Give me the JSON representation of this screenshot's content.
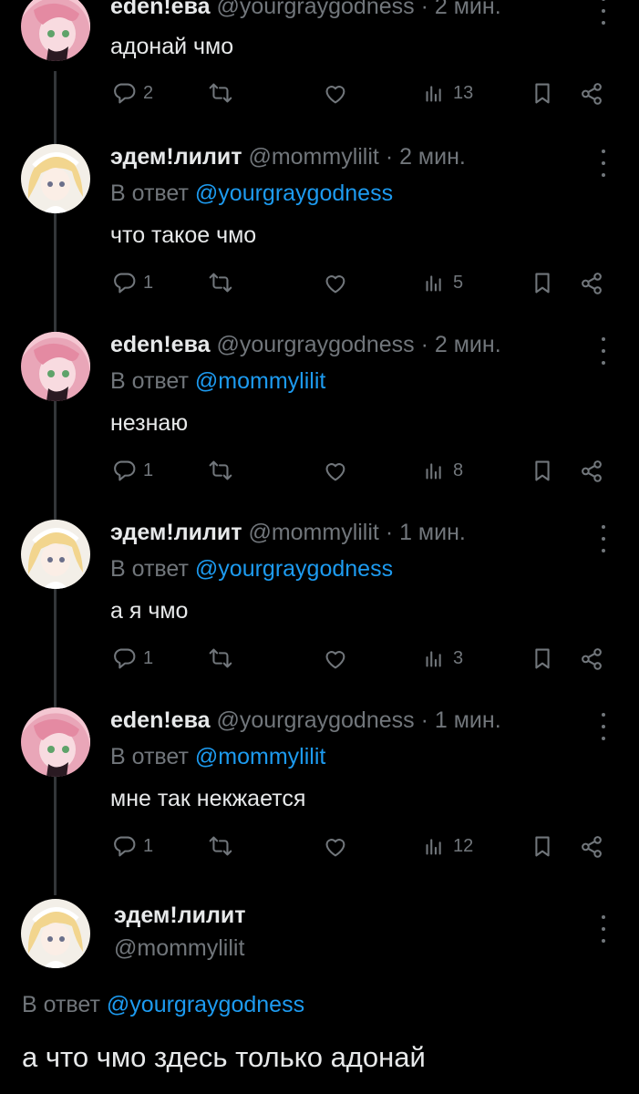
{
  "tweets": [
    {
      "name": "eden!ева",
      "handle": "@yourgraygodness",
      "time": "· 2 мин.",
      "reply_prefix": "",
      "reply_to": "",
      "text": "адонай чмо",
      "replies": "2",
      "views": "13",
      "avatar": "pink"
    },
    {
      "name": "эдем!лилит",
      "handle": "@mommylilit",
      "time": "· 2 мин.",
      "reply_prefix": "В ответ",
      "reply_to": "@yourgraygodness",
      "text": "что такое чмо",
      "replies": "1",
      "views": "5",
      "avatar": "blonde"
    },
    {
      "name": "eden!ева",
      "handle": "@yourgraygodness",
      "time": "· 2 мин.",
      "reply_prefix": "В ответ",
      "reply_to": "@mommylilit",
      "text": "незнаю",
      "replies": "1",
      "views": "8",
      "avatar": "pink"
    },
    {
      "name": "эдем!лилит",
      "handle": "@mommylilit",
      "time": "· 1 мин.",
      "reply_prefix": "В ответ",
      "reply_to": "@yourgraygodness",
      "text": "а я чмо",
      "replies": "1",
      "views": "3",
      "avatar": "blonde"
    },
    {
      "name": "eden!ева",
      "handle": "@yourgraygodness",
      "time": "· 1 мин.",
      "reply_prefix": "В ответ",
      "reply_to": "@mommylilit",
      "text": "мне так некжается",
      "replies": "1",
      "views": "12",
      "avatar": "pink"
    }
  ],
  "main": {
    "name": "эдем!лилит",
    "handle": "@mommylilit",
    "reply_prefix": "В ответ",
    "reply_to": "@yourgraygodness",
    "text": "а что чмо здесь только адонай",
    "avatar": "blonde"
  },
  "colors": {
    "background": "#000000",
    "text": "#e7e9ea",
    "muted": "#71767b",
    "link": "#1d9bf0",
    "thread_line": "#333639"
  },
  "icons": [
    "reply-icon",
    "retweet-icon",
    "like-icon",
    "views-icon",
    "bookmark-icon",
    "share-icon",
    "more-icon"
  ]
}
